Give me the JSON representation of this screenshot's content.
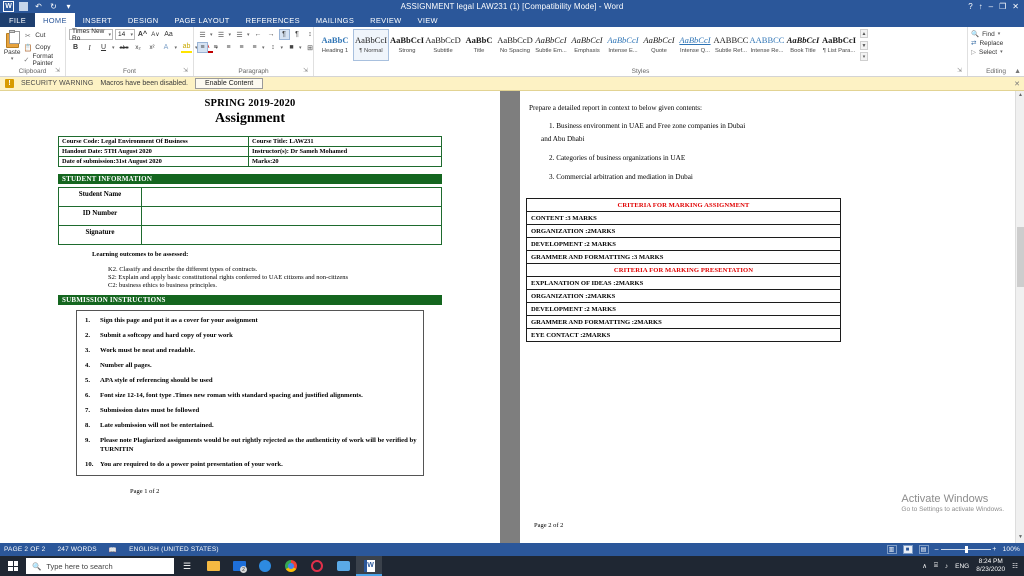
{
  "window": {
    "title": "ASSIGNMENT legal LAW231 (1) [Compatibility Mode] - Word",
    "minimize": "–",
    "maximize": "❐",
    "close": "✕",
    "help": "?",
    "ribbon_display": "↑"
  },
  "quick_access": {
    "word_logo": "W",
    "save": "save-icon",
    "undo": "↶",
    "redo": "↻",
    "more": "▾"
  },
  "tabs": [
    {
      "label": "FILE",
      "active": false
    },
    {
      "label": "HOME",
      "active": true
    },
    {
      "label": "INSERT",
      "active": false
    },
    {
      "label": "DESIGN",
      "active": false
    },
    {
      "label": "PAGE LAYOUT",
      "active": false
    },
    {
      "label": "REFERENCES",
      "active": false
    },
    {
      "label": "MAILINGS",
      "active": false
    },
    {
      "label": "REVIEW",
      "active": false
    },
    {
      "label": "VIEW",
      "active": false
    }
  ],
  "ribbon": {
    "clipboard": {
      "group_label": "Clipboard",
      "paste": "Paste",
      "cut": "Cut",
      "copy": "Copy",
      "format_painter": "Format Painter"
    },
    "font": {
      "group_label": "Font",
      "font_name": "Times New Ro",
      "font_size": "14",
      "grow": "A",
      "shrink": "A",
      "change_case": "Aa",
      "bold": "B",
      "italic": "I",
      "underline": "U",
      "strikethrough": "abc",
      "subscript": "x₂",
      "superscript": "x²",
      "text_effects": "A",
      "highlight": "ab",
      "font_color": "A"
    },
    "paragraph": {
      "group_label": "Paragraph",
      "bullets": "☰",
      "numbering": "☰",
      "multilevel": "☰",
      "decrease_indent": "←",
      "increase_indent": "→",
      "ltr": "¶",
      "rtl": "¶",
      "sort": "↕",
      "show_marks": "¶",
      "align_left": "≡",
      "align_center": "≡",
      "align_right": "≡",
      "justify": "≡",
      "line_spacing": "↕",
      "shading": "■",
      "borders": "⊞"
    },
    "styles": {
      "group_label": "Styles",
      "items": [
        {
          "preview": "AaBbC",
          "name": "Heading 1",
          "selected": false,
          "style": "h1"
        },
        {
          "preview": "AaBbCcI",
          "name": "¶ Normal",
          "selected": true,
          "style": "normal"
        },
        {
          "preview": "AaBbCcI",
          "name": "Strong",
          "selected": false,
          "style": "bold"
        },
        {
          "preview": "AaBbCcD",
          "name": "Subtitle",
          "selected": false,
          "style": "plain"
        },
        {
          "preview": "AaBbC",
          "name": "Title",
          "selected": false,
          "style": "title"
        },
        {
          "preview": "AaBbCcD",
          "name": "No Spacing",
          "selected": false,
          "style": "plain"
        },
        {
          "preview": "AaBbCcI",
          "name": "Subtle Em...",
          "selected": false,
          "style": "italic"
        },
        {
          "preview": "AaBbCcI",
          "name": "Emphasis",
          "selected": false,
          "style": "italic"
        },
        {
          "preview": "AaBbCcI",
          "name": "Intense E...",
          "selected": false,
          "style": "italicblue"
        },
        {
          "preview": "AaBbCcI",
          "name": "Quote",
          "selected": false,
          "style": "italic"
        },
        {
          "preview": "AaBbCcI",
          "name": "Intense Q...",
          "selected": false,
          "style": "italicblueul"
        },
        {
          "preview": "AABBCC",
          "name": "Subtle Ref...",
          "selected": false,
          "style": "caps"
        },
        {
          "preview": "AABBCC",
          "name": "Intense Re...",
          "selected": false,
          "style": "capsblue"
        },
        {
          "preview": "AaBbCcI",
          "name": "Book Title",
          "selected": false,
          "style": "bolditalic"
        },
        {
          "preview": "AaBbCcI",
          "name": "¶ List Para...",
          "selected": false,
          "style": "bold"
        }
      ]
    },
    "editing": {
      "group_label": "Editing",
      "find": "Find",
      "replace": "Replace",
      "select": "Select"
    }
  },
  "security_bar": {
    "label": "SECURITY WARNING",
    "message": "Macros have been disabled.",
    "button": "Enable Content",
    "close": "✕"
  },
  "document": {
    "page1": {
      "heading_line1": "SPRING 2019-2020",
      "heading_line2": "Assignment",
      "info_table": [
        {
          "left": "Course Code: Legal Environment Of Business",
          "right": "Course Title: LAW231"
        },
        {
          "left": "Handout Date: 5TH August 2020",
          "right": "Instructor(s): Dr Sameh Mohamed"
        },
        {
          "left": "Date of submission:31st  August 2020",
          "right": "Marks:20"
        }
      ],
      "student_info_header": "STUDENT INFORMATION",
      "student_rows": [
        {
          "label": "Student Name",
          "value": ""
        },
        {
          "label": "ID Number",
          "value": ""
        },
        {
          "label": "Signature",
          "value": ""
        }
      ],
      "learning_outcomes_title": "Learning outcomes to be assessed:",
      "learning_outcomes": [
        "K2. Classify and describe the different types of contracts.",
        "S2: Explain and apply basic constitutional rights conferred to UAE citizens and non-citizens",
        "C2: business ethics to business principles."
      ],
      "submission_header": "SUBMISSION INSTRUCTIONS",
      "submission_items": [
        "Sign this page and put it as a cover for your assignment",
        "Submit a softcopy and hard copy of your  work",
        "Work must be neat and readable.",
        "Number all pages.",
        "APA style of referencing should be used",
        "Font size 12-14, font type .Times new roman with standard spacing and justified alignments.",
        "Submission dates must be followed",
        "Late submission will not be entertained.",
        "Please note Plagiarized assignments would be out rightly rejected as the authenticity of work will be verified by TURNITIN",
        "You are required to do a power point presentation of your work."
      ],
      "footer": "Page 1 of 2"
    },
    "page2": {
      "intro": "Prepare a detailed report in context to below given contents:",
      "topics": [
        "1. Business environment in UAE and Free zone companies in Dubai",
        "and Abu Dhabi",
        "2. Categories of business organizations in UAE",
        "3. Commercial arbitration and mediation  in Dubai"
      ],
      "criteria_assignment_header": "CRITERIA FOR MARKING ASSIGNMENT",
      "criteria_assignment": [
        "CONTENT :3 MARKS",
        "ORGANIZATION :2MARKS",
        "DEVELOPMENT :2 MARKS",
        "GRAMMER AND FORMATTING :3 MARKS"
      ],
      "criteria_presentation_header": "CRITERIA FOR MARKING PRESENTATION",
      "criteria_presentation": [
        "EXPLANATION OF IDEAS :2MARKS",
        "ORGANIZATION :2MARKS",
        "DEVELOPMENT :2 MARKS",
        "GRAMMER AND FORMATTING :2MARKS",
        "EYE CONTACT :2MARKS"
      ],
      "footer": "Page 2 of 2"
    }
  },
  "watermark": {
    "line1": "Activate Windows",
    "line2": "Go to Settings to activate Windows."
  },
  "status_bar": {
    "page": "PAGE 2 OF 2",
    "words": "247 WORDS",
    "proofing": "proofing-icon",
    "language": "ENGLISH (UNITED STATES)",
    "view_read": "▥",
    "view_print": "■",
    "view_web": "▤",
    "zoom_out": "–",
    "zoom_in": "+",
    "zoom_level": "100%"
  },
  "taskbar": {
    "start": "start-icon",
    "search_placeholder": "Type here to search",
    "task_view": "task-view-icon",
    "apps": [
      {
        "name": "file-explorer-icon",
        "badge": ""
      },
      {
        "name": "mail-icon",
        "badge": "2"
      },
      {
        "name": "edge-icon",
        "badge": ""
      },
      {
        "name": "chrome-icon",
        "badge": ""
      },
      {
        "name": "opera-icon",
        "badge": ""
      },
      {
        "name": "messaging-icon",
        "badge": ""
      },
      {
        "name": "word-icon",
        "badge": ""
      }
    ],
    "tray": {
      "chevron": "∧",
      "network": "⌸",
      "volume": "♪",
      "language": "ENG",
      "time": "8:24 PM",
      "date": "8/23/2020",
      "notifications": "☷"
    }
  },
  "colors": {
    "word_blue": "#2b579a",
    "green_bar": "#14661f",
    "criteria_red": "#e00000",
    "warning_bg": "#fdf2c4"
  }
}
